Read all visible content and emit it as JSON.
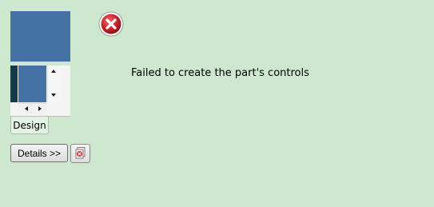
{
  "preview": {
    "tab_label": "Design"
  },
  "error": {
    "icon": "error-icon",
    "message": "Failed to create the part's controls"
  },
  "actions": {
    "details_label": "Details >>",
    "copy_icon": "copy-to-clipboard-icon"
  },
  "colors": {
    "background": "#cde8cf",
    "preview_blue": "#4472a5",
    "error_red": "#c0262b"
  }
}
